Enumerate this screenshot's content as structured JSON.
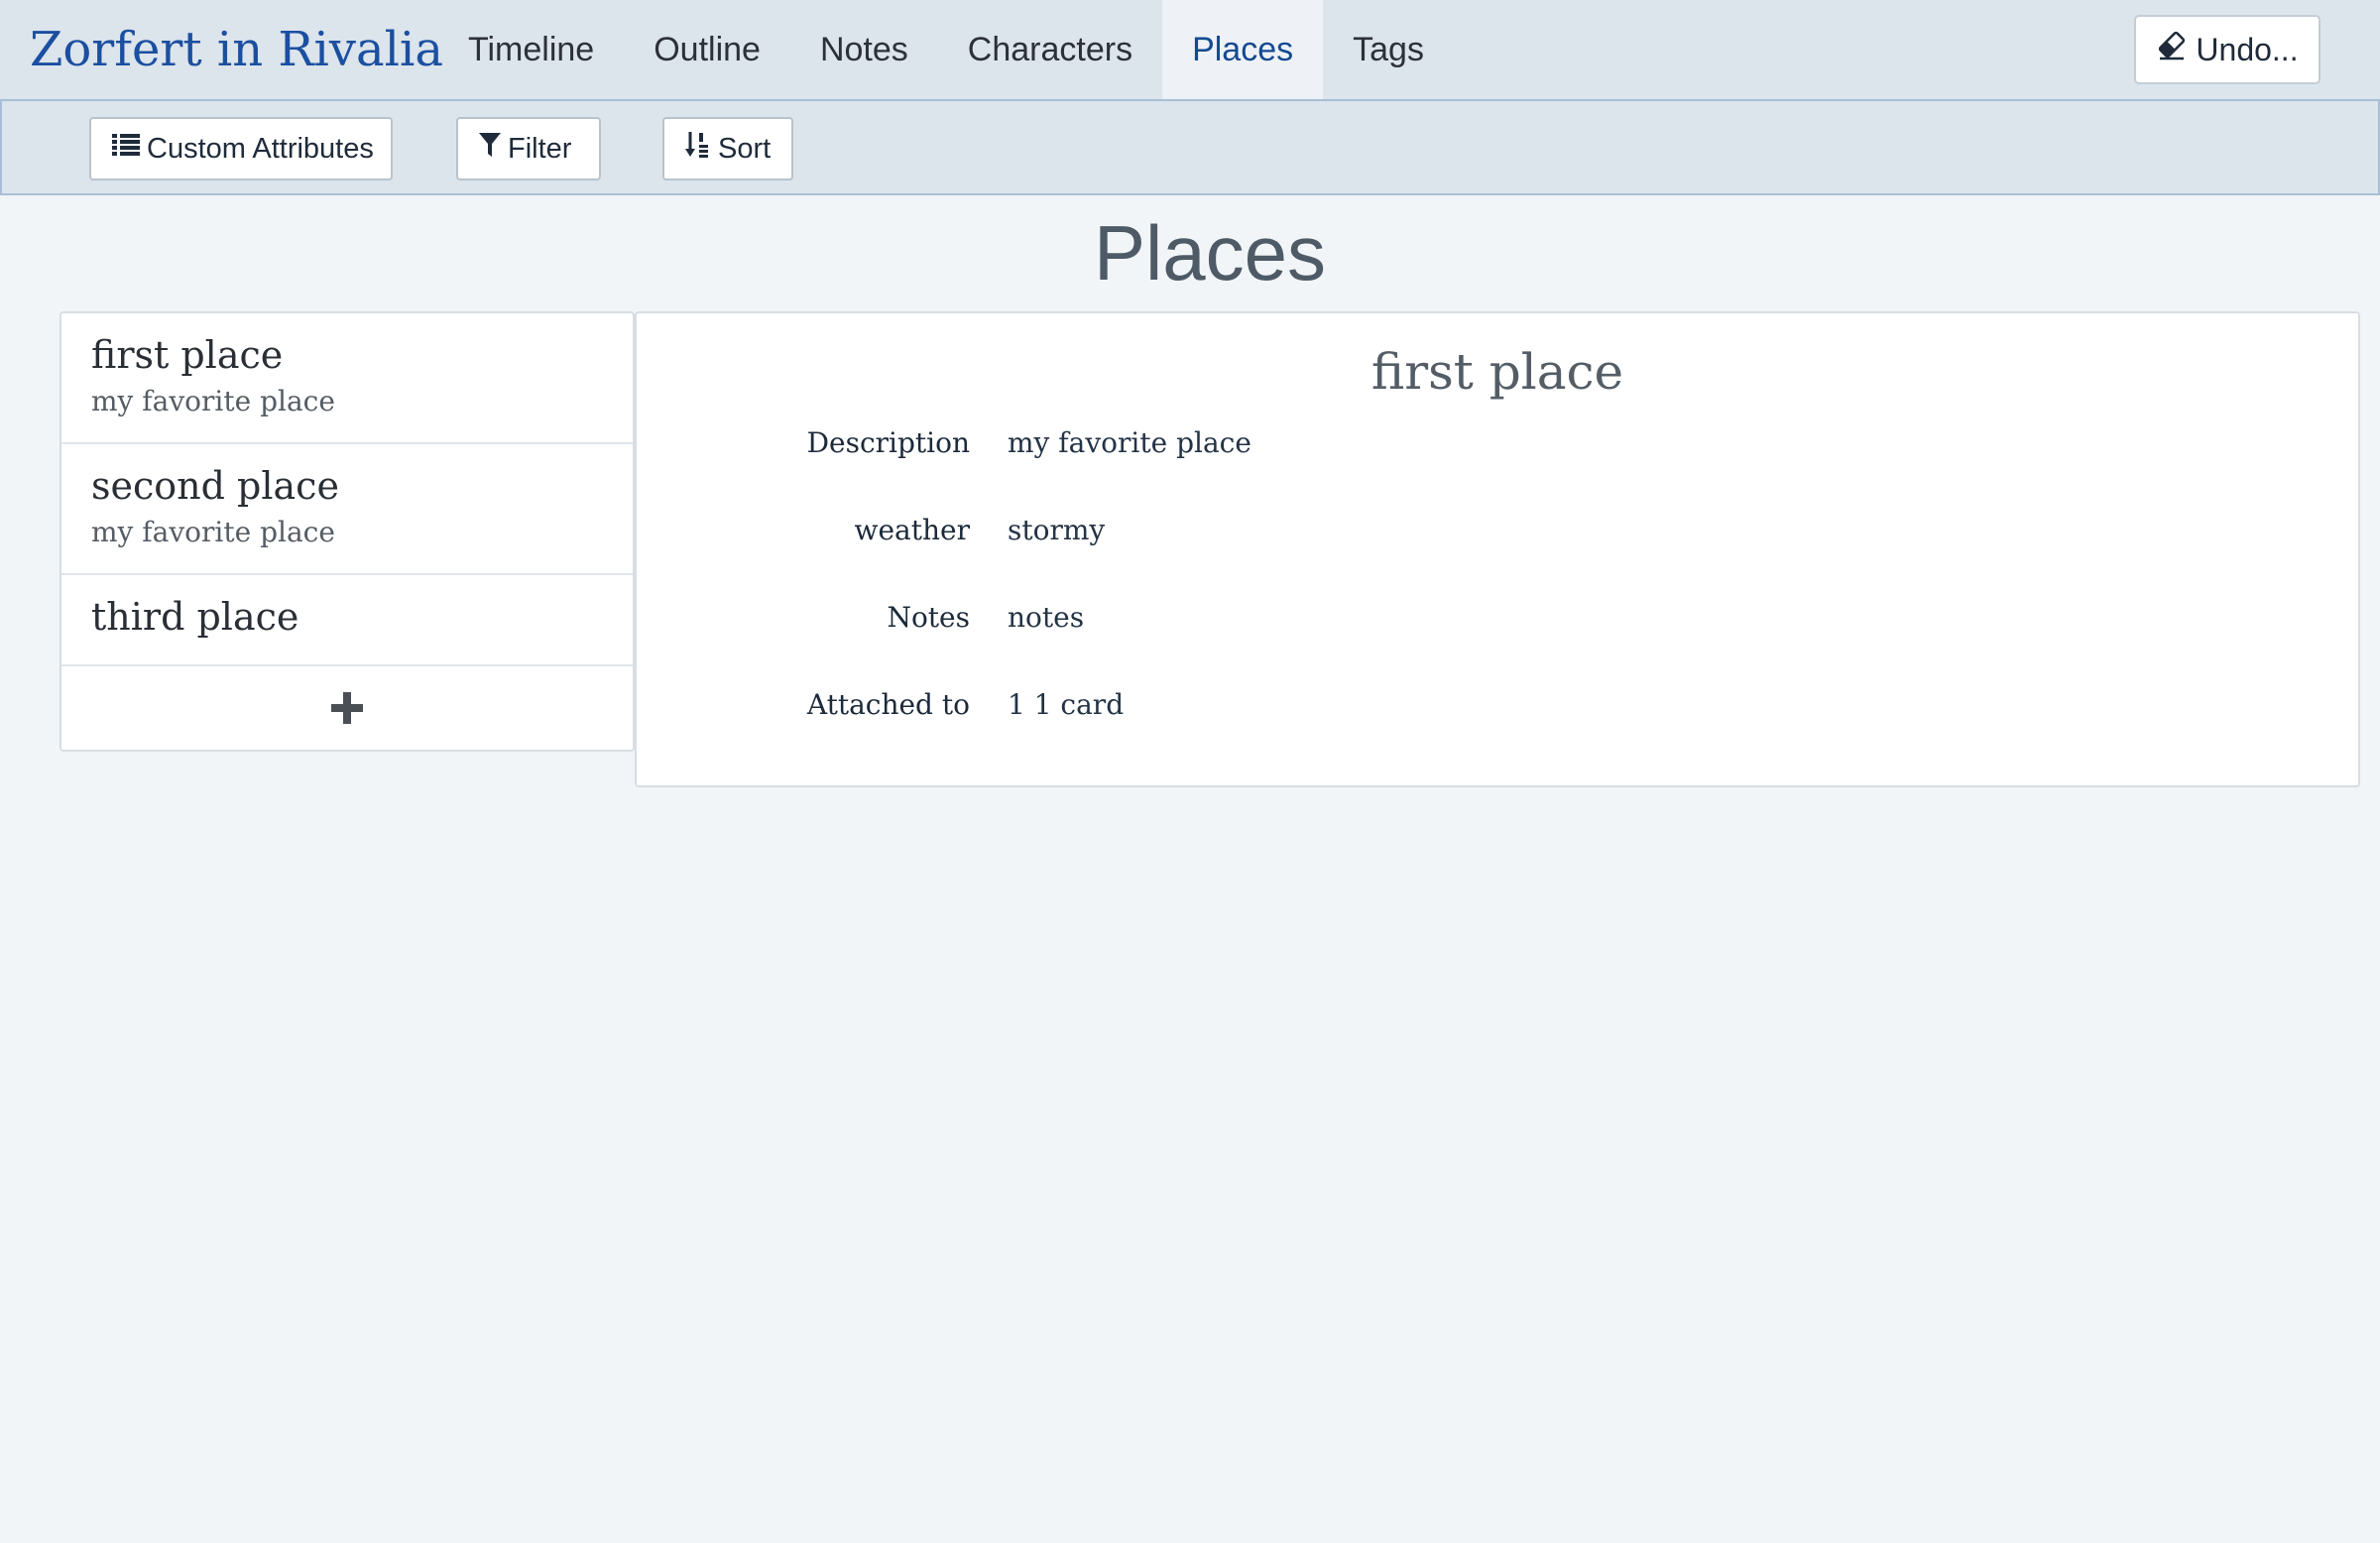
{
  "app": {
    "title": "Zorfert in Rivalia"
  },
  "nav": {
    "tabs": [
      {
        "label": "Timeline"
      },
      {
        "label": "Outline"
      },
      {
        "label": "Notes"
      },
      {
        "label": "Characters"
      },
      {
        "label": "Places",
        "active": true
      },
      {
        "label": "Tags"
      }
    ],
    "undo_label": "Undo...",
    "undo_icon": "eraser-icon"
  },
  "toolbar": {
    "custom_attributes_label": "Custom Attributes",
    "custom_attributes_icon": "list-icon",
    "filter_label": "Filter",
    "filter_icon": "filter-icon",
    "sort_label": "Sort",
    "sort_icon": "sort-icon"
  },
  "page": {
    "title": "Places"
  },
  "places": [
    {
      "name": "first place",
      "description": "my favorite place"
    },
    {
      "name": "second place",
      "description": "my favorite place"
    },
    {
      "name": "third place",
      "description": ""
    }
  ],
  "add_icon": "plus-icon",
  "detail": {
    "title": "first place",
    "attributes": [
      {
        "label": "Description",
        "value": "my favorite place"
      },
      {
        "label": "weather",
        "value": "stormy"
      },
      {
        "label": "Notes",
        "value": "notes"
      },
      {
        "label": "Attached to",
        "value": "1 1 card"
      }
    ]
  },
  "colors": {
    "navbar_bg": "#dce4ec",
    "brand": "#1b4fa0",
    "active_tab_text": "#154a92",
    "page_bg": "#f1f5f8"
  }
}
